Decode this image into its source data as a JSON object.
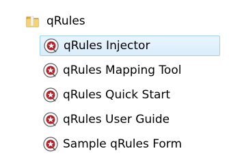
{
  "tree": {
    "folder": {
      "label": "qRules",
      "icon": "folder-icon"
    },
    "items": [
      {
        "label": "qRules Injector",
        "icon": "qrules-app-icon",
        "selected": true
      },
      {
        "label": "qRules Mapping Tool",
        "icon": "qrules-app-icon",
        "selected": false
      },
      {
        "label": "qRules Quick Start",
        "icon": "qrules-app-icon",
        "selected": false
      },
      {
        "label": "qRules User Guide",
        "icon": "qrules-app-icon",
        "selected": false
      },
      {
        "label": "Sample qRules Form",
        "icon": "qrules-app-icon",
        "selected": false
      }
    ]
  },
  "colors": {
    "selection_border": "#9fd0f3",
    "selection_fill": "#d9edfb",
    "folder": "#e8b43c",
    "icon_red": "#b3212a"
  }
}
